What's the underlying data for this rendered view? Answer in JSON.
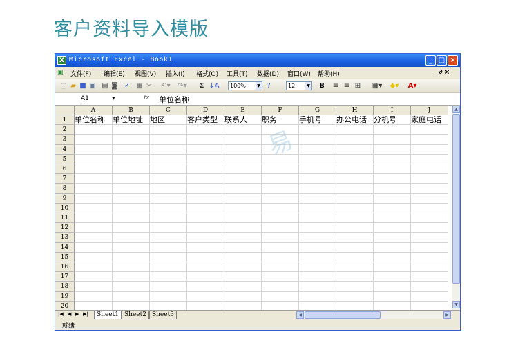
{
  "page_title": "客户资料导入模版",
  "window": {
    "title": "Microsoft Excel - Book1",
    "app_icon": "excel-icon",
    "min": "_",
    "max": "□",
    "close": "×"
  },
  "menu": {
    "items": [
      "文件(F)",
      "编辑(E)",
      "视图(V)",
      "插入(I)",
      "格式(O)",
      "工具(T)",
      "数据(D)",
      "窗口(W)",
      "帮助(H)"
    ],
    "doc_controls": "_ ∂ ×"
  },
  "toolbar": {
    "zoom": "100%",
    "font_size": "12",
    "sum": "Σ",
    "bold": "B"
  },
  "formula_bar": {
    "name_box": "A1",
    "fx": "fx",
    "value": "单位名称"
  },
  "sheet": {
    "columns": [
      "A",
      "B",
      "C",
      "D",
      "E",
      "F",
      "G",
      "H",
      "I",
      "J"
    ],
    "rows": [
      "1",
      "2",
      "3",
      "4",
      "5",
      "6",
      "7",
      "8",
      "9",
      "10",
      "11",
      "12",
      "13",
      "14",
      "15",
      "16",
      "17",
      "18",
      "19",
      "20"
    ],
    "header_row": [
      "单位名称",
      "单位地址",
      "地区",
      "客户类型",
      "联系人",
      "职务",
      "手机号",
      "办公电话",
      "分机号",
      "家庭电话"
    ]
  },
  "tabs": [
    "Sheet1",
    "Sheet2",
    "Sheet3"
  ],
  "status": "就绪",
  "colors": {
    "title": "#2f8fa0",
    "titlebar": "#1a5fe0"
  }
}
